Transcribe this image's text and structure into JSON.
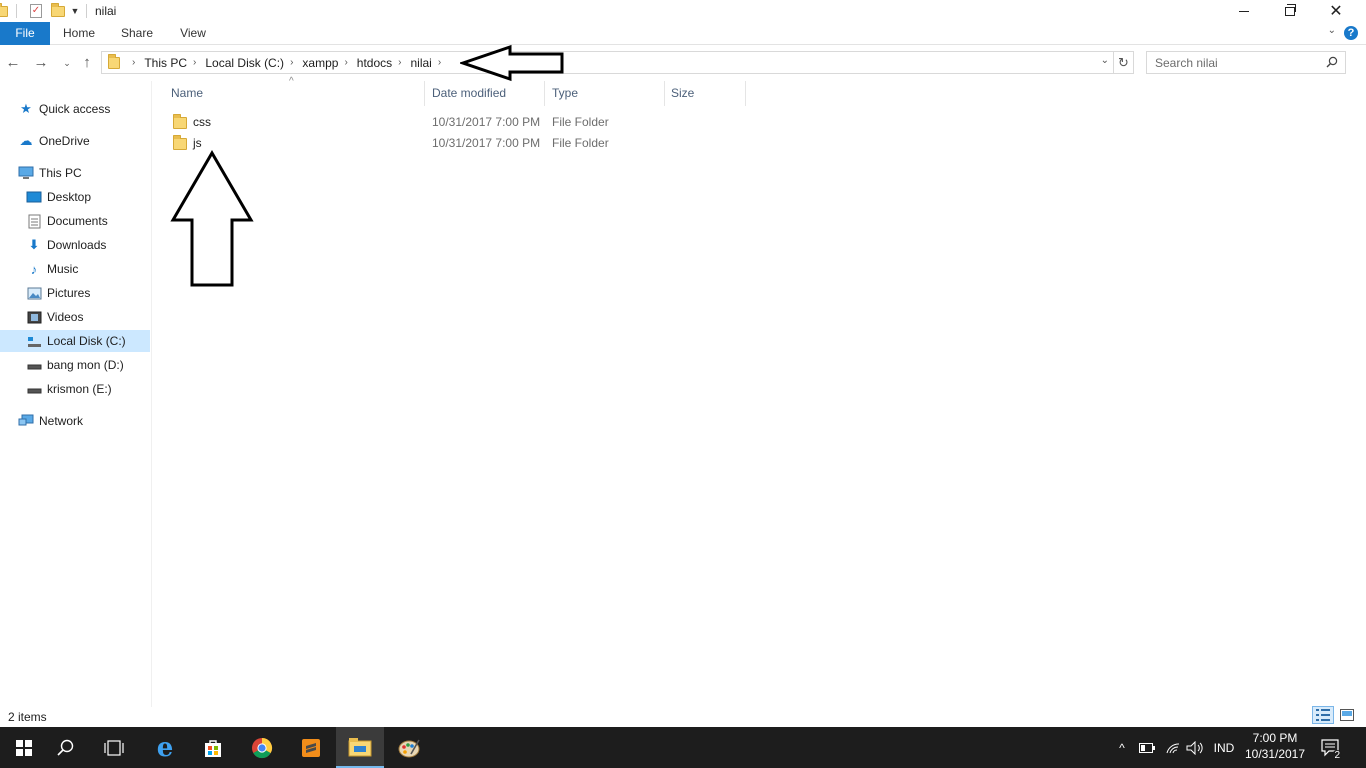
{
  "window": {
    "title": "nilai"
  },
  "ribbon": {
    "tabs": [
      "File",
      "Home",
      "Share",
      "View"
    ],
    "help_label": "?",
    "accent_color": "#1979ca"
  },
  "address": {
    "breadcrumbs": [
      "This PC",
      "Local Disk (C:)",
      "xampp",
      "htdocs",
      "nilai"
    ]
  },
  "search": {
    "placeholder": "Search nilai"
  },
  "navpane": {
    "items": [
      {
        "label": "Quick access",
        "icon": "star-icon"
      },
      {
        "label": "OneDrive",
        "icon": "cloud-icon"
      },
      {
        "label": "This PC",
        "icon": "computer-icon"
      },
      {
        "label": "Desktop",
        "icon": "desktop-icon"
      },
      {
        "label": "Documents",
        "icon": "document-icon"
      },
      {
        "label": "Downloads",
        "icon": "download-icon"
      },
      {
        "label": "Music",
        "icon": "music-icon"
      },
      {
        "label": "Pictures",
        "icon": "pictures-icon"
      },
      {
        "label": "Videos",
        "icon": "video-icon"
      },
      {
        "label": "Local Disk (C:)",
        "icon": "drive-icon",
        "selected": true
      },
      {
        "label": "bang mon (D:)",
        "icon": "drive-icon"
      },
      {
        "label": "krismon (E:)",
        "icon": "drive-icon"
      },
      {
        "label": "Network",
        "icon": "network-icon"
      }
    ]
  },
  "filelist": {
    "columns": [
      "Name",
      "Date modified",
      "Type",
      "Size"
    ],
    "rows": [
      {
        "name": "css",
        "date": "10/31/2017 7:00 PM",
        "type": "File Folder",
        "size": ""
      },
      {
        "name": "js",
        "date": "10/31/2017 7:00 PM",
        "type": "File Folder",
        "size": ""
      }
    ]
  },
  "status": {
    "item_count": "2 items"
  },
  "taskbar": {
    "language": "IND",
    "time": "7:00 PM",
    "date": "10/31/2017",
    "notification_count": "2"
  }
}
